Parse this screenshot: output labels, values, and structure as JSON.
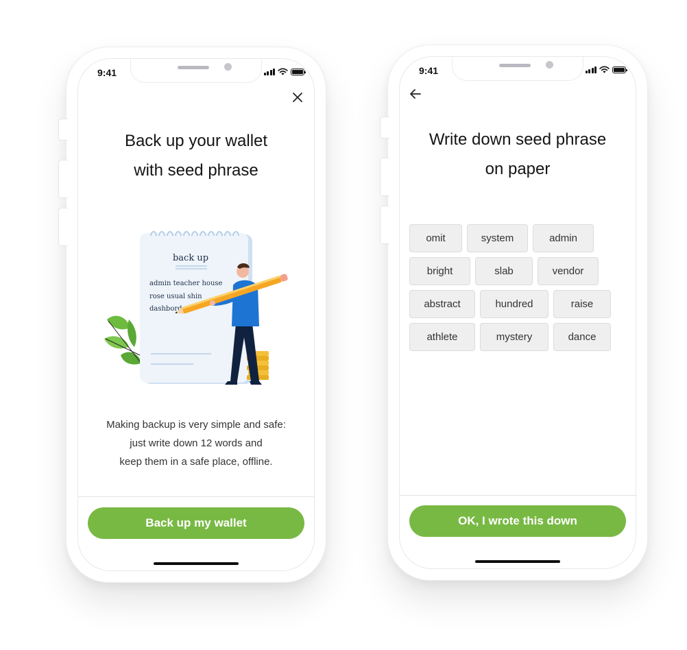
{
  "screens": {
    "backup": {
      "status_time": "9:41",
      "close_icon": "close-icon",
      "title_line1": "Back up your wallet",
      "title_line2": "with seed phrase",
      "illustration": {
        "notebook_heading": "back up",
        "notebook_line1": "admin  teacher  house",
        "notebook_line2": "rose  usual  shin",
        "notebook_line3": "dashbord"
      },
      "desc_line1": "Making backup is very simple and safe:",
      "desc_line2": "just write down 12 words and",
      "desc_line3": "keep them in a safe place, offline.",
      "cta_label": "Back up my wallet"
    },
    "seed": {
      "status_time": "9:41",
      "back_icon": "arrow-left-icon",
      "title_line1": "Write down seed phrase",
      "title_line2": "on paper",
      "rows": [
        [
          "omit",
          "system",
          "admin"
        ],
        [
          "bright",
          "slab",
          "vendor"
        ],
        [
          "abstract",
          "hundred",
          "raise"
        ],
        [
          "athlete",
          "mystery",
          "dance"
        ]
      ],
      "cta_label": "OK, I wrote this down"
    }
  },
  "colors": {
    "accent": "#78b944",
    "chip_bg": "#efefef",
    "chip_border": "#dcdcdc"
  }
}
